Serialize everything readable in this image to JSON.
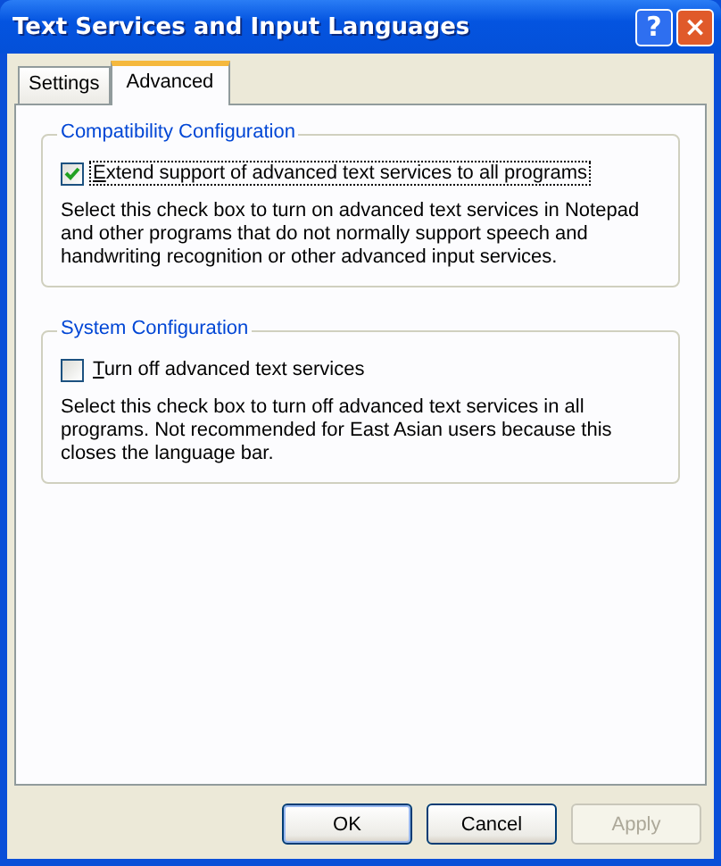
{
  "window": {
    "title": "Text Services and Input Languages",
    "controls": [
      "?",
      "×"
    ]
  },
  "tabs": [
    {
      "label": "Settings",
      "selected": false
    },
    {
      "label": "Advanced",
      "selected": true
    }
  ],
  "groups": [
    {
      "title": "Compatibility Configuration",
      "checkbox": {
        "label": "Extend support of advanced text services to all programs",
        "checked": true,
        "focused": true
      },
      "description": "Select this check box to turn on advanced text services in Notepad and other programs that do not normally support speech and handwriting recognition or other advanced input services."
    },
    {
      "title": "System Configuration",
      "checkbox": {
        "label": "Turn off advanced text services",
        "checked": false,
        "focused": false
      },
      "description": "Select this check box to turn off advanced text services in all programs. Not recommended for East Asian users because this closes the language bar."
    }
  ],
  "buttons": [
    {
      "label": "OK",
      "disabled": false,
      "default": true
    },
    {
      "label": "Cancel",
      "disabled": false,
      "default": false
    },
    {
      "label": "Apply",
      "disabled": true,
      "default": false
    }
  ]
}
